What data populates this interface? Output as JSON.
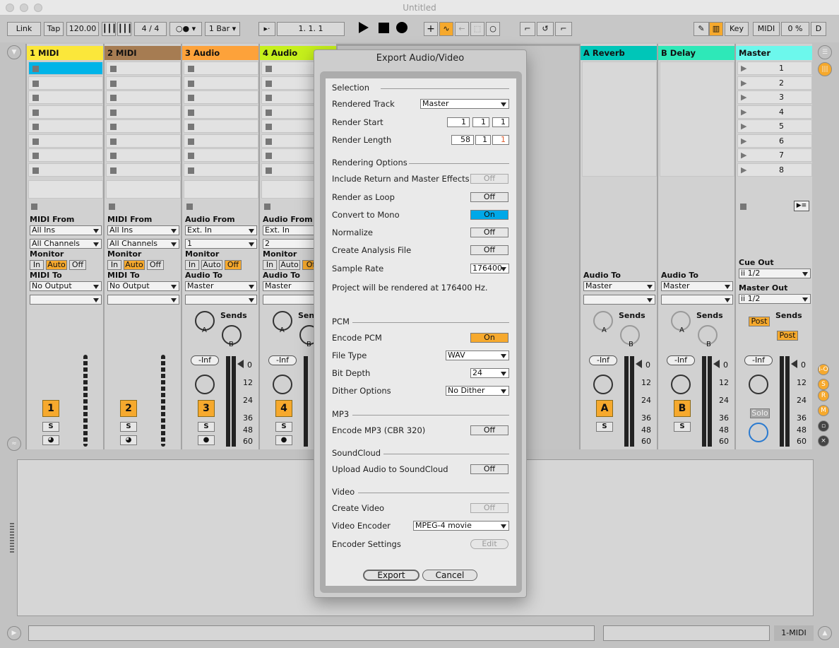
{
  "window": {
    "title": "Untitled"
  },
  "control_bar": {
    "link": "Link",
    "tap": "Tap",
    "tempo": "120.00",
    "meter_num": "4",
    "meter_slash": "/",
    "meter_den": "4",
    "quantize": "1 Bar",
    "position": "1.   1.   1",
    "key": "Key",
    "midi": "MIDI",
    "cpu": "0 %",
    "d": "D"
  },
  "tracks": [
    {
      "name": "1 MIDI",
      "color": "#fbe73a",
      "type": "midi",
      "from_label": "MIDI From",
      "from": "All Ins",
      "channel": "All Channels",
      "monitor_label": "Monitor",
      "mon": [
        "In",
        "Auto",
        "Off"
      ],
      "mon_active": 1,
      "to_label": "MIDI To",
      "to": "No Output",
      "number": "1"
    },
    {
      "name": "2 MIDI",
      "color": "#a67c52",
      "type": "midi",
      "from_label": "MIDI From",
      "from": "All Ins",
      "channel": "All Channels",
      "monitor_label": "Monitor",
      "mon": [
        "In",
        "Auto",
        "Off"
      ],
      "mon_active": 1,
      "to_label": "MIDI To",
      "to": "No Output",
      "number": "2"
    },
    {
      "name": "3 Audio",
      "color": "#fda23a",
      "type": "audio",
      "from_label": "Audio From",
      "from": "Ext. In",
      "channel": "1",
      "monitor_label": "Monitor",
      "mon": [
        "In",
        "Auto",
        "Off"
      ],
      "mon_active": 2,
      "to_label": "Audio To",
      "to": "Master",
      "number": "3",
      "sends": "Sends",
      "send_a": "A",
      "send_b": "B",
      "vol": "-Inf"
    },
    {
      "name": "4 Audio",
      "color": "#c6f01c",
      "type": "audio",
      "from_label": "Audio From",
      "from": "Ext. In",
      "channel": "2",
      "monitor_label": "Monitor",
      "mon": [
        "In",
        "Auto",
        "Of"
      ],
      "mon_active": 2,
      "to_label": "Audio To",
      "to": "Master",
      "number": "4",
      "sends": "Sen",
      "send_a": "A",
      "send_b": "B",
      "vol": "-Inf"
    }
  ],
  "returns": [
    {
      "name": "A Reverb",
      "color": "#00c6b8",
      "to_label": "Audio To",
      "to": "Master",
      "sends": "Sends",
      "send_a": "A",
      "send_b": "B",
      "vol": "-Inf",
      "letter": "A"
    },
    {
      "name": "B Delay",
      "color": "#2ee8b8",
      "to_label": "Audio To",
      "to": "Master",
      "sends": "Sends",
      "send_a": "A",
      "send_b": "B",
      "vol": "-Inf",
      "letter": "B"
    }
  ],
  "master": {
    "name": "Master",
    "color": "#6cf8ec",
    "scenes": [
      "1",
      "2",
      "3",
      "4",
      "5",
      "6",
      "7",
      "8"
    ],
    "cue_label": "Cue Out",
    "cue": "1/2",
    "out_label": "Master Out",
    "out": "1/2",
    "sends": "Sends",
    "post": "Post",
    "vol": "-Inf",
    "solo": "Solo"
  },
  "meter_scale": [
    "0",
    "12",
    "24",
    "36",
    "48",
    "60"
  ],
  "side_buttons": [
    "I-O",
    "S",
    "R",
    "M"
  ],
  "status": {
    "track": "1-MIDI"
  },
  "dialog": {
    "title": "Export Audio/Video",
    "selection": "Selection",
    "rendered_track_label": "Rendered Track",
    "rendered_track": "Master",
    "render_start_label": "Render Start",
    "render_start": [
      "1",
      "1",
      "1"
    ],
    "render_length_label": "Render Length",
    "render_length": [
      "58",
      "1",
      "1"
    ],
    "rendering_options": "Rendering Options",
    "include_label": "Include Return and Master Effects",
    "include": "Off",
    "loop_label": "Render as Loop",
    "loop": "Off",
    "mono_label": "Convert to Mono",
    "mono": "On",
    "normalize_label": "Normalize",
    "normalize": "Off",
    "analysis_label": "Create Analysis File",
    "analysis": "Off",
    "sample_rate_label": "Sample Rate",
    "sample_rate": "176400",
    "project_note": "Project will be rendered at 176400 Hz.",
    "pcm": "PCM",
    "encode_pcm_label": "Encode PCM",
    "encode_pcm": "On",
    "file_type_label": "File Type",
    "file_type": "WAV",
    "bit_depth_label": "Bit Depth",
    "bit_depth": "24",
    "dither_label": "Dither Options",
    "dither": "No Dither",
    "mp3": "MP3",
    "encode_mp3_label": "Encode MP3 (CBR 320)",
    "encode_mp3": "Off",
    "soundcloud": "SoundCloud",
    "upload_label": "Upload Audio to SoundCloud",
    "upload": "Off",
    "video": "Video",
    "create_video_label": "Create Video",
    "create_video": "Off",
    "video_encoder_label": "Video Encoder",
    "video_encoder": "MPEG-4 movie",
    "encoder_settings_label": "Encoder Settings",
    "encoder_settings": "Edit",
    "export": "Export",
    "cancel": "Cancel"
  }
}
